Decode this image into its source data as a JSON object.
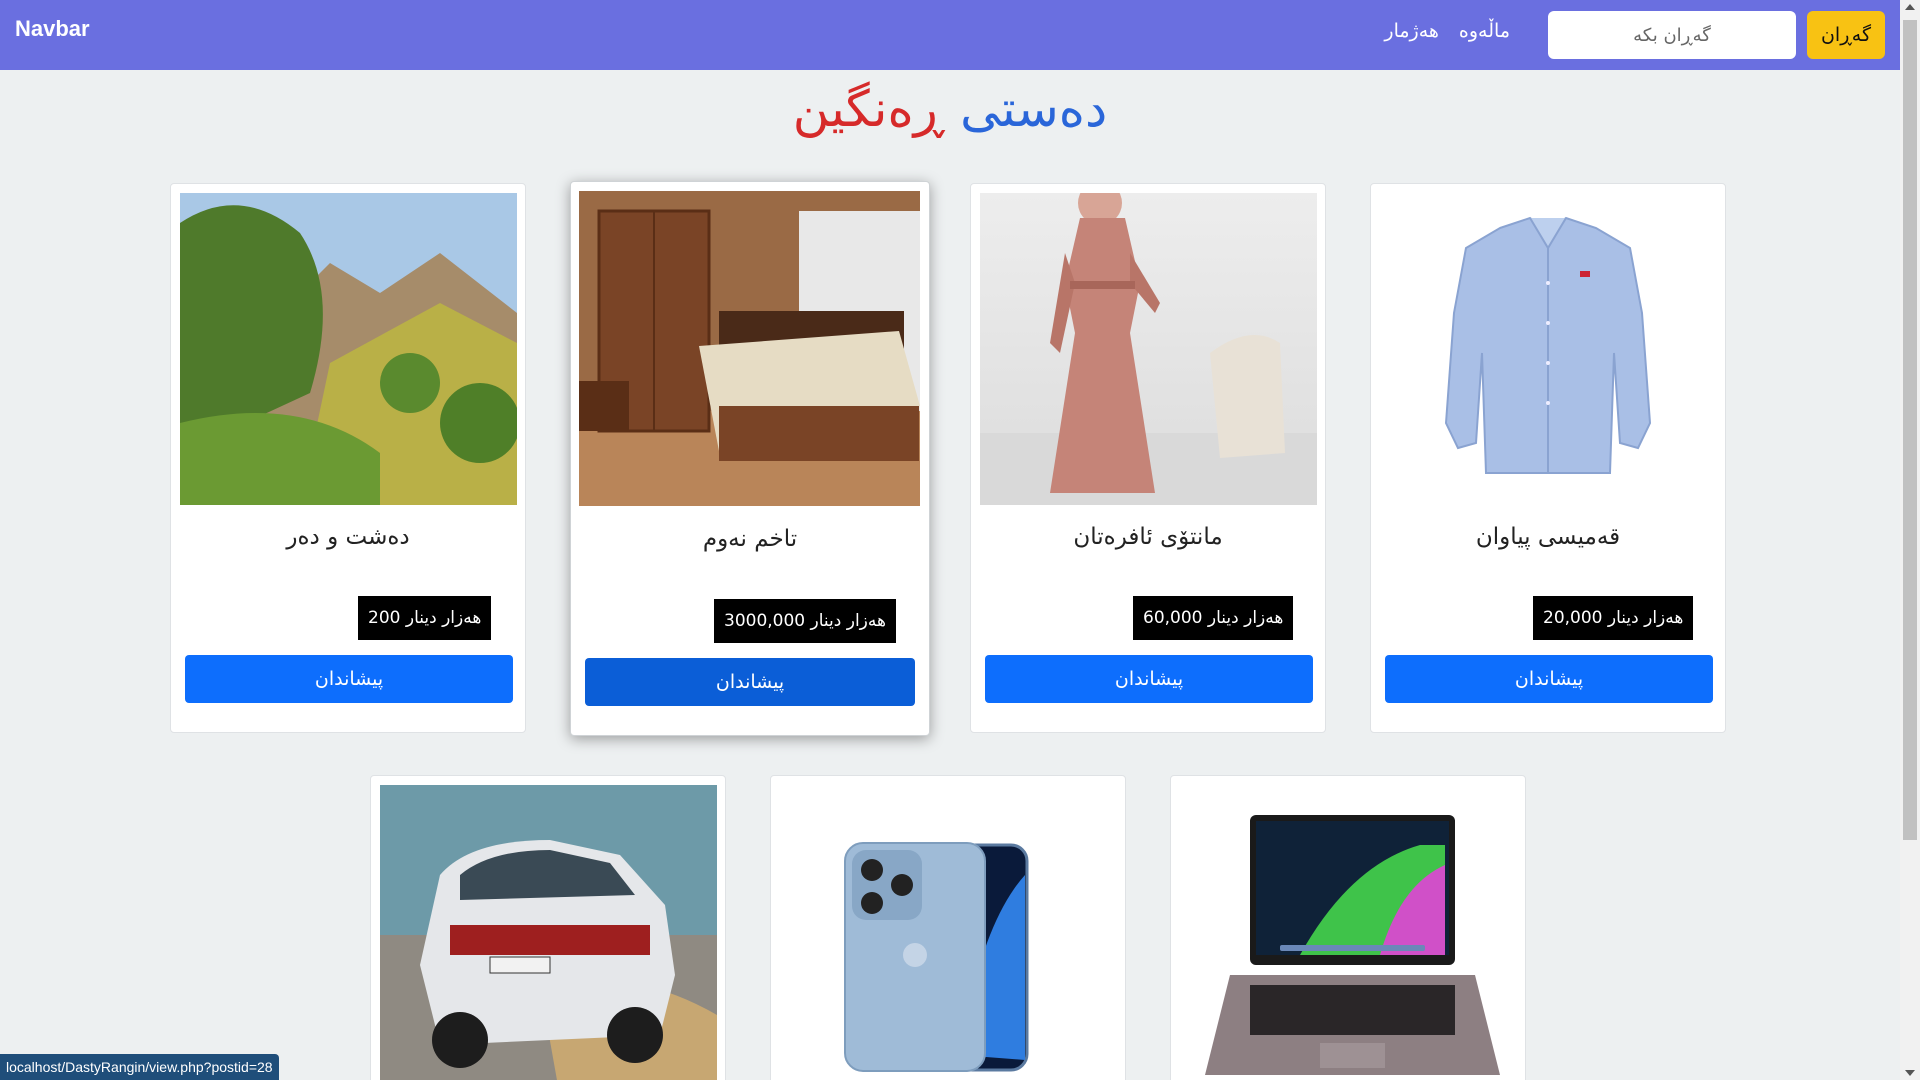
{
  "navbar": {
    "brand": "Navbar",
    "links": [
      "ماڵەوە",
      "هەژمار"
    ],
    "search_placeholder": "گەڕان بکە",
    "search_button": "گەڕان",
    "bg_color": "#6a6fe0",
    "search_button_color": "#f8c213"
  },
  "title": {
    "part1": "دەستی",
    "part2": "ڕەنگین"
  },
  "cards": [
    {
      "title": "قەمیسی پیاوان",
      "price": "هەزار دینار 20,000",
      "button": "پیشاندان",
      "image": "shirt-image"
    },
    {
      "title": "مانتۆی ئافرەتان",
      "price": "هەزار دینار 60,000",
      "button": "پیشاندان",
      "image": "dress-image"
    },
    {
      "title": "تاخم نەوم",
      "price": "هەزار دینار 3000,000",
      "button": "پیشاندان",
      "image": "bedroom-image"
    },
    {
      "title": "دەشت و دەر",
      "price": "هەزار دینار 200",
      "button": "پیشاندان",
      "image": "landscape-image"
    },
    {
      "title": "",
      "price": "",
      "button": "",
      "image": "laptop-image"
    },
    {
      "title": "",
      "price": "",
      "button": "",
      "image": "phone-image"
    },
    {
      "title": "",
      "price": "",
      "button": "",
      "image": "car-image"
    }
  ],
  "status_url": "localhost/DastyRangin/view.php?postid=28",
  "colors": {
    "primary": "#0d6efd",
    "title_blue": "#2a66d9",
    "title_red": "#d62a2a"
  }
}
